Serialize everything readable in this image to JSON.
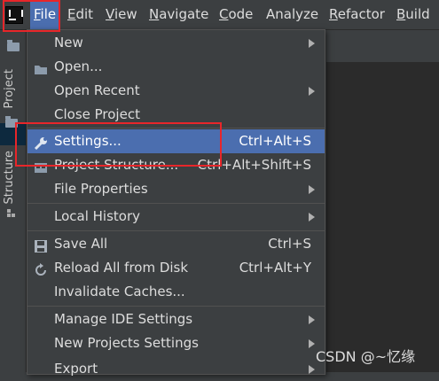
{
  "menubar": {
    "logo": "IntelliJ IDEA",
    "items": [
      {
        "label": "File",
        "mnemonic": "F",
        "rest": "ile"
      },
      {
        "label": "Edit",
        "mnemonic": "E",
        "rest": "dit"
      },
      {
        "label": "View",
        "mnemonic": "V",
        "rest": "iew"
      },
      {
        "label": "Navigate",
        "mnemonic": "N",
        "rest": "avigate"
      },
      {
        "label": "Code",
        "mnemonic": "C",
        "rest": "ode"
      },
      {
        "label": "Analyze",
        "mnemonic": "",
        "rest": "Analyze"
      },
      {
        "label": "Refactor",
        "mnemonic": "R",
        "rest": "efactor"
      },
      {
        "label": "Build",
        "mnemonic": "B",
        "rest": "uild"
      }
    ]
  },
  "toolstrip": {
    "project_tab": "Project",
    "structure_tab": "Structure"
  },
  "file_menu": {
    "items": [
      {
        "label": "New",
        "shortcut": "",
        "submenu": true
      },
      {
        "label": "Open...",
        "shortcut": "",
        "submenu": false
      },
      {
        "label": "Open Recent",
        "shortcut": "",
        "submenu": true
      },
      {
        "label": "Close Project",
        "shortcut": "",
        "submenu": false
      },
      {
        "label": "Settings...",
        "shortcut": "Ctrl+Alt+S",
        "submenu": false
      },
      {
        "label": "Project Structure...",
        "shortcut": "Ctrl+Alt+Shift+S",
        "submenu": false
      },
      {
        "label": "File Properties",
        "shortcut": "",
        "submenu": true
      },
      {
        "label": "Local History",
        "shortcut": "",
        "submenu": true
      },
      {
        "label": "Save All",
        "shortcut": "Ctrl+S",
        "submenu": false
      },
      {
        "label": "Reload All from Disk",
        "shortcut": "Ctrl+Alt+Y",
        "submenu": false
      },
      {
        "label": "Invalidate Caches...",
        "shortcut": "",
        "submenu": false
      },
      {
        "label": "Manage IDE Settings",
        "shortcut": "",
        "submenu": true
      },
      {
        "label": "New Projects Settings",
        "shortcut": "",
        "submenu": true
      },
      {
        "label": "Export",
        "shortcut": "",
        "submenu": true
      }
    ]
  },
  "watermark": "CSDN @~忆缘",
  "colors": {
    "selection": "#4b6eaf",
    "highlight_box": "#e8262a",
    "menu_bg": "#3c3f41"
  }
}
